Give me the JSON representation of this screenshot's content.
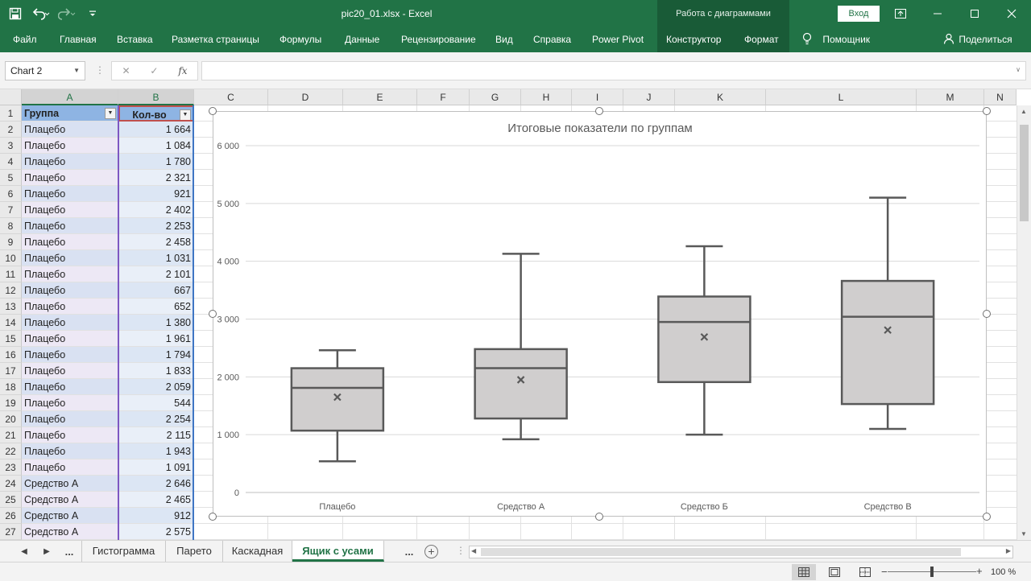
{
  "app": {
    "doc_title": "pic20_01.xlsx  -  Excel",
    "chart_tools_label": "Работа с диаграммами",
    "signin_label": "Вход"
  },
  "ribbon": {
    "tabs": [
      "Файл",
      "Главная",
      "Вставка",
      "Разметка страницы",
      "Формулы",
      "Данные",
      "Рецензирование",
      "Вид",
      "Справка",
      "Power Pivot",
      "Конструктор",
      "Формат"
    ],
    "tell_me": "Помощник",
    "share": "Поделиться"
  },
  "formula_bar": {
    "name_box": "Chart 2",
    "fx_label": "fx",
    "formula": ""
  },
  "columns": [
    "A",
    "B",
    "C",
    "D",
    "E",
    "F",
    "G",
    "H",
    "I",
    "J",
    "K",
    "L",
    "M",
    "N"
  ],
  "table": {
    "headers": [
      "Группа",
      "Кол-во"
    ],
    "rows": [
      [
        "Плацебо",
        "1 664"
      ],
      [
        "Плацебо",
        "1 084"
      ],
      [
        "Плацебо",
        "1 780"
      ],
      [
        "Плацебо",
        "2 321"
      ],
      [
        "Плацебо",
        "921"
      ],
      [
        "Плацебо",
        "2 402"
      ],
      [
        "Плацебо",
        "2 253"
      ],
      [
        "Плацебо",
        "2 458"
      ],
      [
        "Плацебо",
        "1 031"
      ],
      [
        "Плацебо",
        "2 101"
      ],
      [
        "Плацебо",
        "667"
      ],
      [
        "Плацебо",
        "652"
      ],
      [
        "Плацебо",
        "1 380"
      ],
      [
        "Плацебо",
        "1 961"
      ],
      [
        "Плацебо",
        "1 794"
      ],
      [
        "Плацебо",
        "1 833"
      ],
      [
        "Плацебо",
        "2 059"
      ],
      [
        "Плацебо",
        "544"
      ],
      [
        "Плацебо",
        "2 254"
      ],
      [
        "Плацебо",
        "2 115"
      ],
      [
        "Плацебо",
        "1 943"
      ],
      [
        "Плацебо",
        "1 091"
      ],
      [
        "Средство А",
        "2 646"
      ],
      [
        "Средство А",
        "2 465"
      ],
      [
        "Средство А",
        "912"
      ],
      [
        "Средство А",
        "2 575"
      ]
    ]
  },
  "chart_data": {
    "type": "box",
    "title": "Итоговые показатели по группам",
    "xlabel": "",
    "ylabel": "",
    "ylim": [
      0,
      6000
    ],
    "yticks": [
      0,
      1000,
      2000,
      3000,
      4000,
      5000,
      6000
    ],
    "ytick_labels": [
      "0",
      "1 000",
      "2 000",
      "3 000",
      "4 000",
      "5 000",
      "6 000"
    ],
    "grid": true,
    "legend": "none",
    "categories": [
      "Плацебо",
      "Средство А",
      "Средство Б",
      "Средство В"
    ],
    "boxes": [
      {
        "min": 540,
        "q1": 1070,
        "median": 1810,
        "q3": 2150,
        "max": 2460,
        "mean": 1650
      },
      {
        "min": 920,
        "q1": 1280,
        "median": 2150,
        "q3": 2480,
        "max": 4130,
        "mean": 1950
      },
      {
        "min": 1000,
        "q1": 1910,
        "median": 2950,
        "q3": 3390,
        "max": 4260,
        "mean": 2690
      },
      {
        "min": 1100,
        "q1": 1530,
        "median": 3040,
        "q3": 3660,
        "max": 5100,
        "mean": 2810
      }
    ],
    "box_fill": "#d0cece",
    "box_stroke": "#595959"
  },
  "sheets": {
    "more_label": "...",
    "tabs": [
      "Гистограмма",
      "Парето",
      "Каскадная",
      "Ящик с усами"
    ],
    "active": "Ящик с усами"
  },
  "status": {
    "zoom": "100 %"
  },
  "colors": {
    "excel_green": "#217346",
    "ribbon_context": "#195b37"
  }
}
